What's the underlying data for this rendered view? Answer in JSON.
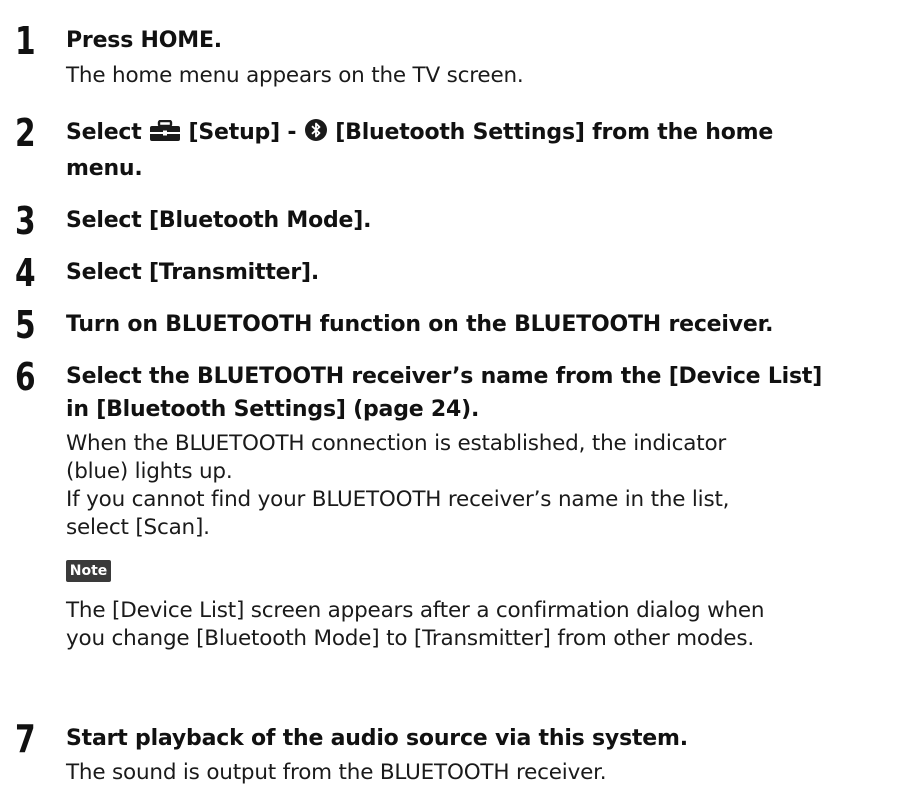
{
  "steps": [
    {
      "number": "1",
      "heading": "Press HOME.",
      "body": [
        "The home menu appears on the TV screen."
      ]
    },
    {
      "number": "2",
      "heading_parts": {
        "pre": "Select",
        "setup": "[Setup] -",
        "bt": "[Bluetooth Settings] from the home",
        "line2": "menu."
      },
      "icons": [
        "toolbox-icon",
        "bluetooth-icon"
      ]
    },
    {
      "number": "3",
      "heading": "Select [Bluetooth Mode]."
    },
    {
      "number": "4",
      "heading": "Select [Transmitter]."
    },
    {
      "number": "5",
      "heading": "Turn on BLUETOOTH function on the BLUETOOTH receiver."
    },
    {
      "number": "6",
      "heading_lines": [
        "Select the BLUETOOTH receiver’s name from the [Device List]",
        "in [Bluetooth Settings] (page 24)."
      ],
      "body": [
        "When the BLUETOOTH connection is established, the indicator",
        "(blue) lights up.",
        "If you cannot find your BLUETOOTH receiver’s name in the list,",
        "select [Scan]."
      ],
      "note": {
        "label": "Note",
        "lines": [
          "The [Device List] screen appears after a confirmation dialog when",
          "you change [Bluetooth Mode] to [Transmitter] from other modes."
        ]
      }
    },
    {
      "number": "7",
      "heading": "Start playback of the audio source via this system.",
      "body": [
        "The sound is output from the BLUETOOTH receiver."
      ]
    }
  ]
}
